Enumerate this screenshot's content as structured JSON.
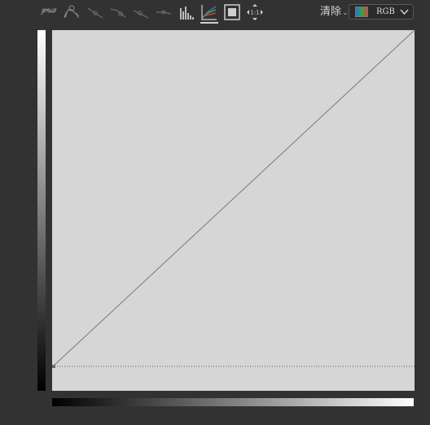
{
  "toolbar": {
    "icons": [
      {
        "name": "edit-curve-points-icon"
      },
      {
        "name": "draw-curve-pencil-icon"
      },
      {
        "name": "smooth-curve-icon"
      },
      {
        "name": "move-points-icon"
      },
      {
        "name": "add-point-icon"
      },
      {
        "name": "delete-point-icon"
      },
      {
        "name": "histogram-icon"
      },
      {
        "name": "channel-overlays-icon",
        "active": true
      },
      {
        "name": "fit-to-window-icon"
      },
      {
        "name": "actual-size-icon",
        "label": "1:1"
      }
    ],
    "clear_label": "清除",
    "channel": {
      "selected": "RGB",
      "swatch_colors": [
        "#2d6de0",
        "#2aa64a",
        "#d2483a"
      ]
    }
  },
  "curve": {
    "channel": "RGB",
    "points": [
      [
        0,
        0
      ],
      [
        255,
        255
      ]
    ],
    "input_range": [
      0,
      255
    ],
    "output_range": [
      0,
      255
    ]
  },
  "colors": {
    "background": "#323232",
    "graph_background": "#d6d6d6",
    "curve_line": "#7a7a7a"
  }
}
